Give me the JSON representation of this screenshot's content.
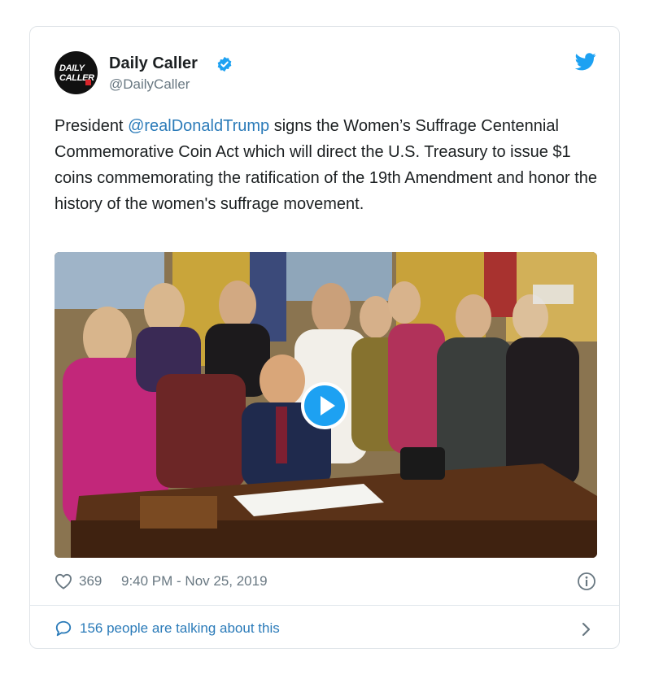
{
  "tweet": {
    "author_name": "Daily Caller",
    "author_handle": "@DailyCaller",
    "avatar_text_line1": "DAILY",
    "avatar_text_line2": "CALLER",
    "text_before": "President ",
    "mention": "@realDonaldTrump",
    "text_after": " signs the Women’s Suffrage Centennial Commemorative Coin Act which will direct the U.S. Treasury to issue $1 coins commemorating the ratification of the 19th Amendment and honor the history of the women's suffrage movement.",
    "likes": "369",
    "timestamp": "9:40 PM - Nov 25, 2019",
    "talking": "156 people are talking about this"
  },
  "icons": {
    "verified": "verified-badge-icon",
    "brand": "twitter-bird-icon",
    "like": "heart-icon",
    "info": "info-icon",
    "reply": "speech-bubble-icon",
    "chevron": "chevron-right-icon",
    "play": "play-icon"
  },
  "colors": {
    "link": "#2b7bb9",
    "brand": "#1da1f2",
    "muted": "#697882"
  }
}
